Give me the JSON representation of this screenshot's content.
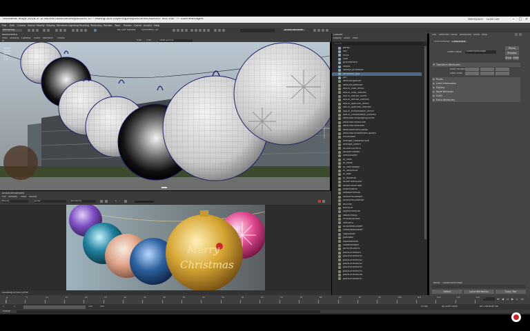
{
  "window": {
    "title": "Autodesk Maya 2018.3: D:\\WORK\\Tutorials\\Mayas\\Unit 07 - Mixing and Layering\\Maya\\scenes\\robot07 v01.mb* --- XGenManaged",
    "user": "Workspace",
    "login": "Lozel Lee"
  },
  "menus": [
    "File",
    "Edit",
    "Create",
    "Select",
    "Modify",
    "Display",
    "Windows",
    "Lighting/Shading",
    "Texturing",
    "Render",
    "Toon",
    "Stereo",
    "Cache",
    "Arnold",
    "Help"
  ],
  "toolbar": {
    "module": "Rendering",
    "no_live": "No Live Surface",
    "symmetry": "Symmetry: Off",
    "render_preset": "Arnold Renderer"
  },
  "viewport": {
    "menus": [
      "View",
      "Shading",
      "Lighting",
      "Show",
      "Renderer",
      "Panels"
    ],
    "camera_field": "sRGB gamma",
    "hud": [
      "Verts:",
      "Edges:",
      "Faces:",
      "Tris:",
      "UVs:"
    ],
    "exposure": "0.00",
    "gamma": "1.00"
  },
  "render_view": {
    "title": "Arnold RenderView",
    "menus": [
      "File",
      "Window",
      "View",
      "Render"
    ],
    "camera": "Beauty",
    "aov": "persp",
    "mode": "Rendering",
    "frame_count": "1",
    "greeting_line1": "Merry",
    "greeting_line2": "Christmas",
    "status": "Updating Arnold Scene"
  },
  "outliner": {
    "title": "Outliner",
    "menus": [
      "Display",
      "Show",
      "Help"
    ],
    "search_placeholder": "Search...",
    "items": [
      "persp",
      "top",
      "front",
      "side",
      "groundPlane",
      "layout",
      "sphere_ornament",
      "ornament_grp",
      "ptn",
      "defaultLightSet",
      "defaultObjectSet",
      "aiAOV_coat_direct",
      "aiAOV_coat_indirect",
      "aiAOV_diffuse_direct",
      "aiAOV_diffuse_indirect",
      "aiAOV_specular_direct",
      "aiAOV_specular_indirect",
      "aiAOV_transmission_direct",
      "aiAOV_transmission_indirect",
      "defaultArnoldDisplayDriver",
      "defaultArnoldDriver",
      "defaultArnoldFilter",
      "defaultRenderQuality",
      "defaultArnoldRenderOptions",
      "aiStandard",
      "aiImage_rosesMultiple",
      "aiImage_bokeh",
      "aiColorCorrect1",
      "aiLayerShader",
      "aiMixShader",
      "ai_flake",
      "ai_noise",
      "ai_normalMap",
      "ai_rampRGB",
      "ai_toon",
      "ai_triplanar",
      "aiUserDataColor",
      "aiUserDataFloat",
      "aiWireframe",
      "aiMotionVector",
      "aiVolumeSample",
      "aiVolumeCollector",
      "aiUtility",
      "bump2d",
      "layeredTexture",
      "aiBlackbody",
      "multiplyDivide",
      "lambert1",
      "ornamentShader",
      "snowflakeShader",
      "capShader",
      "glassBall",
      "hookMaterial",
      "shadowMatte",
      "particleCloud1",
      "place2dTexture",
      "place2dTexture1",
      "place2dTexture2",
      "place2dTexture3",
      "place2dTexture4",
      "place2dTexture5",
      "place2dTexture6",
      "place2dTexture7"
    ],
    "selected_index": 7
  },
  "attribute_editor": {
    "tabs": [
      "List",
      "Selected",
      "Focus",
      "Attributes",
      "Show",
      "Help"
    ],
    "node_tabs": [
      "OceanSettings",
      "OceanPlane"
    ],
    "focus_button": "Focus",
    "presets_button": "Presets",
    "show_button": "Show",
    "hide_button": "Hide",
    "node_label": "OceanPlaneShape",
    "node_type_label": "Ocean Plane",
    "sections": [
      "Transform Attributes",
      "Pivots",
      "Limit Information",
      "Display",
      "Node Behavior",
      "UUID",
      "Extra Attributes"
    ],
    "translate_label": "Local Position",
    "scale_label": "Local Scale",
    "notes_label": "Notes:",
    "notes_value": "OceanPlaneShape",
    "bottom_buttons": [
      "Select",
      "Load Attributes",
      "Copy Tab"
    ]
  },
  "timeline": {
    "ticks": [
      "1",
      "5",
      "10",
      "15",
      "20",
      "25",
      "30",
      "35",
      "40",
      "45",
      "50",
      "55",
      "60",
      "65",
      "70",
      "75",
      "80",
      "85",
      "90",
      "95",
      "100",
      "105",
      "110",
      "115",
      "120"
    ],
    "start": "1",
    "end": "120",
    "current_frame": "1",
    "fps": "24 fps",
    "range_start": "1",
    "range_end": "200",
    "anim_layer": "No Anim Layer",
    "char_set": "No Character Set"
  },
  "cmdline": {
    "language": "Python"
  },
  "colors": {
    "panel": "#3c3c3c",
    "selected": "#4a6a8a",
    "accent": "#5285a6",
    "render_gold": "#d8a735"
  }
}
